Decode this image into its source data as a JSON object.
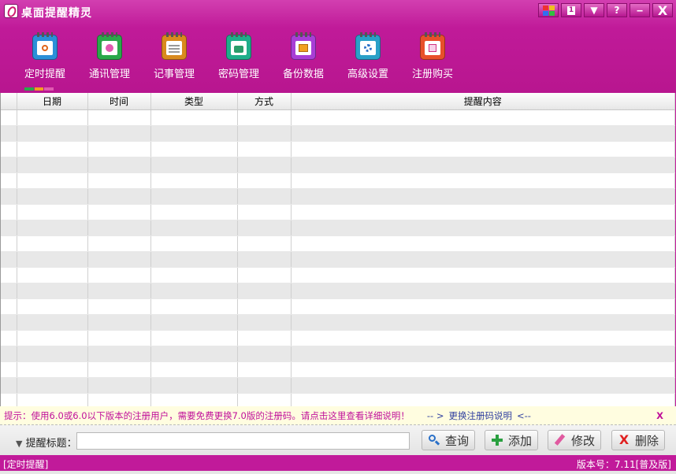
{
  "app": {
    "title": "桌面提醒精灵"
  },
  "window_controls": {
    "skin_icon": "skin-palette-icon",
    "calendar_icon": "calendar-icon",
    "calendar_glyph": "1",
    "dropdown": "▼",
    "help": "?",
    "minimize": "‒",
    "close": "X"
  },
  "toolbar": {
    "items": [
      {
        "label": "定时提醒",
        "icon": "alarm-clock-icon",
        "color": "#2b8fd8"
      },
      {
        "label": "通讯管理",
        "icon": "contacts-icon",
        "color": "#2aa84a"
      },
      {
        "label": "记事管理",
        "icon": "notepad-icon",
        "color": "#d98a1e"
      },
      {
        "label": "密码管理",
        "icon": "password-lock-icon",
        "color": "#1fae8a"
      },
      {
        "label": "备份数据",
        "icon": "backup-disk-icon",
        "color": "#a83ed6"
      },
      {
        "label": "高级设置",
        "icon": "settings-gear-icon",
        "color": "#2aa0c8"
      },
      {
        "label": "注册购买",
        "icon": "register-purchase-icon",
        "color": "#e8502a"
      }
    ]
  },
  "table": {
    "columns": [
      "",
      "日期",
      "时间",
      "类型",
      "方式",
      "提醒内容"
    ],
    "row_count": 19
  },
  "hint": {
    "message": "提示：使用6.0或6.0以下版本的注册用户，需要免费更换7.0版的注册码。请点击这里查看详细说明！",
    "arrow_left": "-- >",
    "link": "更换注册码说明",
    "arrow_right": "<--",
    "close": "X"
  },
  "search": {
    "label": "提醒标题：",
    "value": "",
    "buttons": {
      "query": "查询",
      "add": "添加",
      "edit": "修改",
      "delete": "删除"
    }
  },
  "status": {
    "left": "[定时提醒]",
    "right": "版本号：7.11[普及版]"
  },
  "colors": {
    "theme": "#c01a99",
    "hint_text": "#c0109a",
    "link": "#3040a0"
  }
}
